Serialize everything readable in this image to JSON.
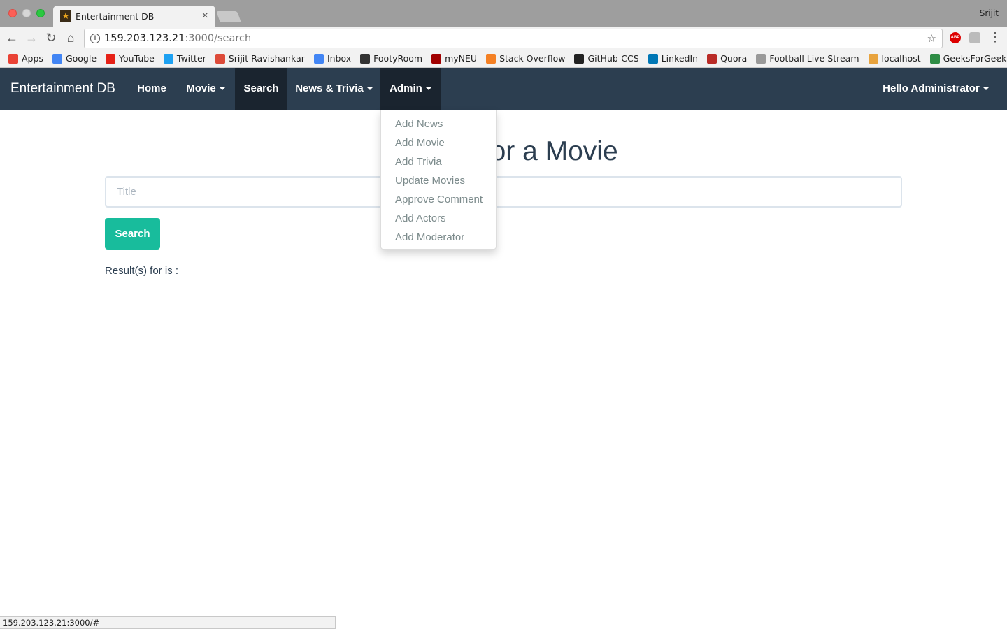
{
  "browser": {
    "tab_title": "Entertainment DB",
    "user_name": "Srijit",
    "url_host": "159.203.123.21",
    "url_path": ":3000/search",
    "status_url": "159.203.123.21:3000/#",
    "bookmarks": [
      {
        "label": "Apps",
        "icon": "apps-grid-icon",
        "color": "#e94235"
      },
      {
        "label": "Google",
        "icon": "google-icon",
        "color": "#4285f4"
      },
      {
        "label": "YouTube",
        "icon": "youtube-icon",
        "color": "#e62117"
      },
      {
        "label": "Twitter",
        "icon": "twitter-icon",
        "color": "#1da1f2"
      },
      {
        "label": "Srijit Ravishankar",
        "icon": "google-plus-icon",
        "color": "#dd4b39"
      },
      {
        "label": "Inbox",
        "icon": "inbox-icon",
        "color": "#4285f4"
      },
      {
        "label": "FootyRoom",
        "icon": "footyroom-icon",
        "color": "#333333"
      },
      {
        "label": "myNEU",
        "icon": "paw-icon",
        "color": "#a00000"
      },
      {
        "label": "Stack Overflow",
        "icon": "stackoverflow-icon",
        "color": "#f48024"
      },
      {
        "label": "GitHub-CCS",
        "icon": "github-icon",
        "color": "#222222"
      },
      {
        "label": "LinkedIn",
        "icon": "linkedin-icon",
        "color": "#0077b5"
      },
      {
        "label": "Quora",
        "icon": "quora-icon",
        "color": "#b92b27"
      },
      {
        "label": "Football Live Stream",
        "icon": "page-icon",
        "color": "#999999"
      },
      {
        "label": "localhost",
        "icon": "localhost-icon",
        "color": "#e8a33d"
      },
      {
        "label": "GeeksForGeeks",
        "icon": "geeksforgeeks-icon",
        "color": "#2f8d46"
      }
    ],
    "bookmarks_overflow": "»"
  },
  "navbar": {
    "brand": "Entertainment DB",
    "items": [
      {
        "label": "Home",
        "caret": false
      },
      {
        "label": "Movie",
        "caret": true
      },
      {
        "label": "Search",
        "caret": false,
        "active": true
      },
      {
        "label": "News & Trivia",
        "caret": true
      },
      {
        "label": "Admin",
        "caret": true,
        "active": true
      }
    ],
    "user_menu": "Hello Administrator"
  },
  "admin_dropdown": {
    "items": [
      "Add News",
      "Add Movie",
      "Add Trivia",
      "Update Movies",
      "Approve Comment",
      "Add Actors",
      "Add Moderator"
    ]
  },
  "page": {
    "heading_visible": "or a Movie",
    "title_placeholder": "Title",
    "search_button": "Search",
    "results_text": "Result(s) for is :"
  },
  "colors": {
    "navbar_bg": "#2c3e50",
    "navbar_active_bg": "#1a242f",
    "primary_button": "#18bc9c",
    "dropdown_text": "#7b8a8b"
  }
}
